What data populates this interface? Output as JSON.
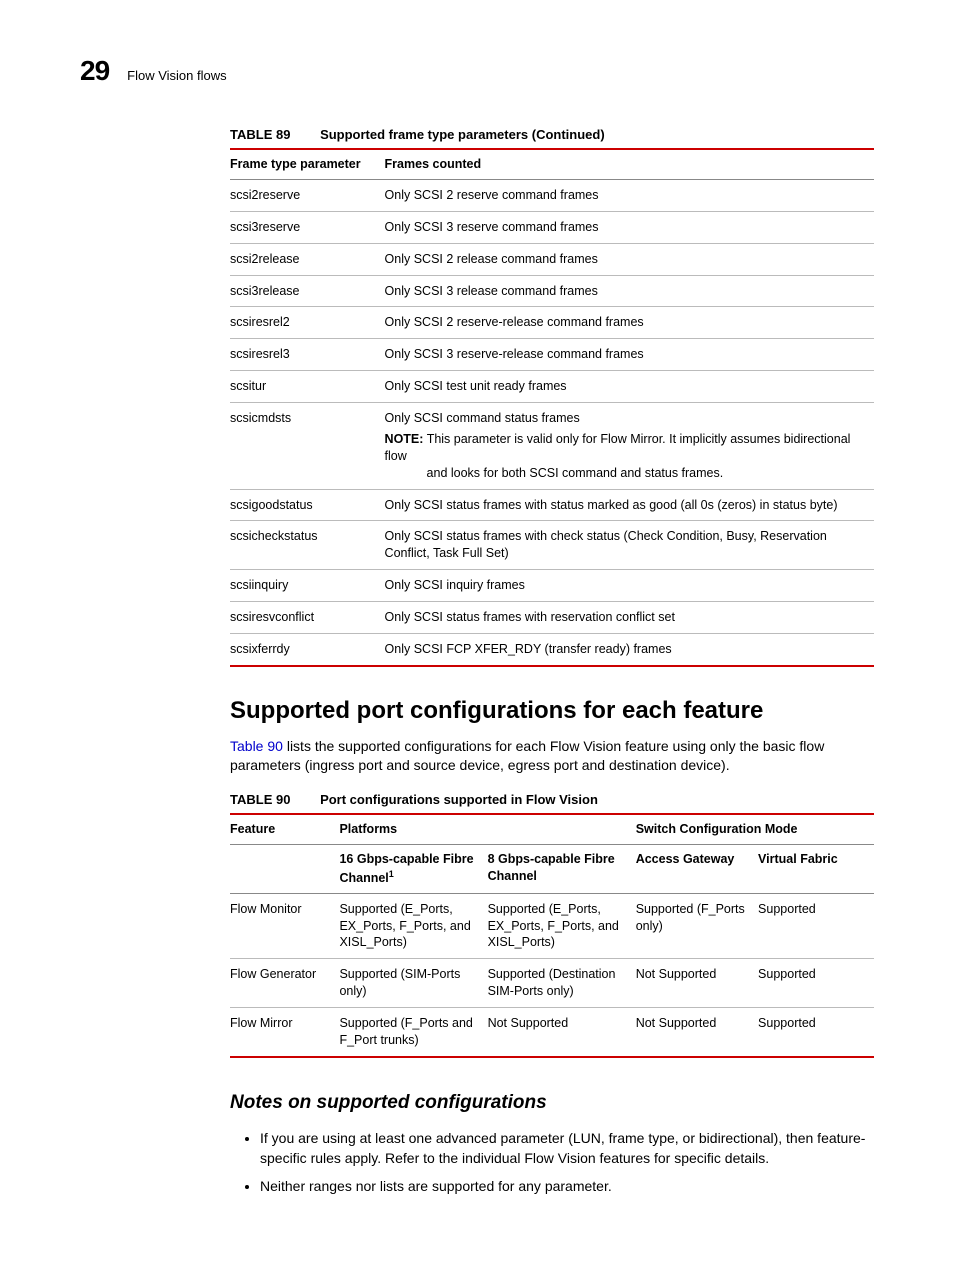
{
  "header": {
    "chapter_number": "29",
    "breadcrumb": "Flow Vision flows"
  },
  "table89": {
    "label": "TABLE 89",
    "title": "Supported frame type parameters (Continued)",
    "columns": [
      "Frame type parameter",
      "Frames counted"
    ],
    "rows": [
      {
        "p": "scsi2reserve",
        "desc": "Only SCSI 2 reserve command frames"
      },
      {
        "p": "scsi3reserve",
        "desc": "Only SCSI 3 reserve command frames"
      },
      {
        "p": "scsi2release",
        "desc": "Only SCSI 2 release command frames"
      },
      {
        "p": "scsi3release",
        "desc": "Only SCSI 3 release command frames"
      },
      {
        "p": "scsiresrel2",
        "desc": "Only SCSI 2 reserve-release command frames"
      },
      {
        "p": "scsiresrel3",
        "desc": "Only SCSI 3 reserve-release command frames"
      },
      {
        "p": "scsitur",
        "desc": "Only SCSI test unit ready frames"
      },
      {
        "p": "scsicmdsts",
        "desc": "Only SCSI command status frames",
        "note_label": "NOTE:",
        "note": "This parameter is valid only for Flow Mirror. It implicitly assumes bidirectional flow",
        "note_cont": "and looks for both SCSI command and status frames."
      },
      {
        "p": "scsigoodstatus",
        "desc": "Only SCSI status frames with status marked as good (all 0s (zeros) in status byte)"
      },
      {
        "p": "scsicheckstatus",
        "desc": "Only SCSI status frames with check status (Check Condition, Busy, Reservation Conflict, Task Full Set)"
      },
      {
        "p": "scsiinquiry",
        "desc": "Only SCSI inquiry frames"
      },
      {
        "p": "scsiresvconflict",
        "desc": "Only SCSI status frames with reservation conflict set"
      },
      {
        "p": "scsixferrdy",
        "desc": "Only SCSI FCP XFER_RDY (transfer ready) frames"
      }
    ]
  },
  "section": {
    "heading": "Supported port configurations for each feature",
    "intro_pre": "",
    "xref": "Table 90",
    "intro_post": " lists the supported configurations for each Flow Vision feature using only the basic flow parameters (ingress port and source device, egress port and destination device)."
  },
  "table90": {
    "label": "TABLE 90",
    "title": "Port configurations supported in Flow Vision",
    "group_headers": {
      "feature": "Feature",
      "platforms": "Platforms",
      "switch_mode": "Switch Configuration Mode"
    },
    "sub_headers": {
      "c16": "16 Gbps-capable Fibre Channel",
      "c16_foot": "1",
      "c8": "8 Gbps-capable Fibre Channel",
      "ag": "Access Gateway",
      "vf": "Virtual Fabric"
    },
    "rows": [
      {
        "feature": "Flow Monitor",
        "c16": "Supported (E_Ports, EX_Ports, F_Ports, and XISL_Ports)",
        "c8": "Supported (E_Ports, EX_Ports, F_Ports, and XISL_Ports)",
        "ag": "Supported (F_Ports only)",
        "vf": "Supported"
      },
      {
        "feature": "Flow Generator",
        "c16": "Supported (SIM-Ports only)",
        "c8": "Supported (Destination SIM-Ports only)",
        "ag": "Not Supported",
        "vf": "Supported"
      },
      {
        "feature": "Flow Mirror",
        "c16": "Supported (F_Ports and F_Port trunks)",
        "c8": "Not Supported",
        "ag": "Not Supported",
        "vf": "Supported"
      }
    ]
  },
  "subsection": {
    "heading": "Notes on supported configurations",
    "bullets": [
      "If you are using at least one advanced parameter (LUN, frame type, or bidirectional), then feature-specific rules apply. Refer to the individual Flow Vision features for specific details.",
      "Neither ranges nor lists are supported for any parameter."
    ]
  }
}
